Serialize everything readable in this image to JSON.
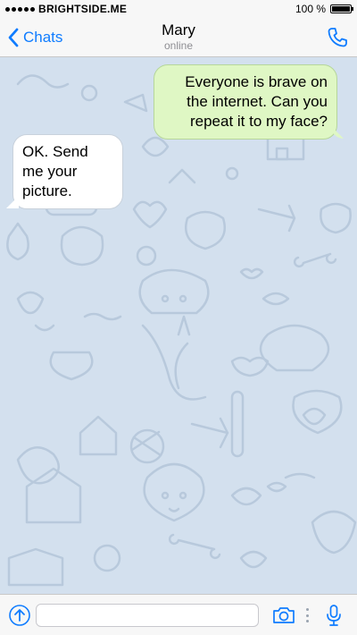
{
  "status_bar": {
    "carrier": "BRIGHTSIDE.ME",
    "battery_text": "100 %",
    "battery_level": 1.0
  },
  "nav": {
    "back_label": "Chats",
    "contact_name": "Mary",
    "contact_status": "online"
  },
  "messages": [
    {
      "direction": "outgoing",
      "text": "Everyone is brave on the internet. Can you repeat it to my face?"
    },
    {
      "direction": "incoming",
      "text": "OK. Send me your picture."
    }
  ],
  "input": {
    "placeholder": "",
    "value": ""
  },
  "icons": {
    "back": "chevron-left-icon",
    "call": "phone-icon",
    "attach": "attach-icon",
    "camera": "camera-icon",
    "menu": "more-vertical-icon",
    "mic": "microphone-icon"
  },
  "colors": {
    "accent": "#0f7cff",
    "chat_background": "#d3e0ee",
    "outgoing_bubble": "#dff7c4",
    "incoming_bubble": "#ffffff"
  }
}
